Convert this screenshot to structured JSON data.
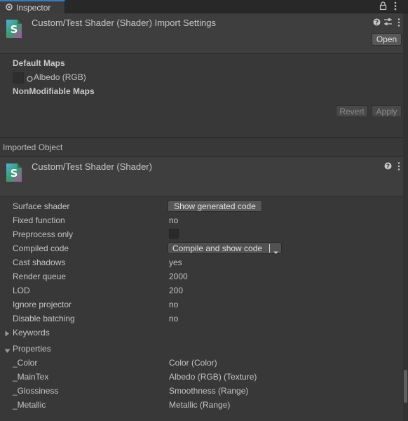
{
  "tab": {
    "label": "Inspector"
  },
  "header": {
    "title": "Custom/Test Shader (Shader) Import Settings",
    "open_label": "Open",
    "help_icon": "help-icon",
    "preset_icon": "preset-sliders-icon",
    "menu_icon": "kebab-menu-icon"
  },
  "maps": {
    "default_title": "Default Maps",
    "albedo_label": "Albedo (RGB)",
    "nonmodifiable_title": "NonModifiable Maps"
  },
  "actions": {
    "revert_label": "Revert",
    "apply_label": "Apply"
  },
  "imported": {
    "section_label": "Imported Object",
    "title": "Custom/Test Shader (Shader)"
  },
  "props": {
    "surface_shader_label": "Surface shader",
    "show_generated_label": "Show generated code",
    "fixed_function_label": "Fixed function",
    "fixed_function_value": "no",
    "preprocess_label": "Preprocess only",
    "compiled_code_label": "Compiled code",
    "compile_btn_label": "Compile and show code",
    "cast_shadows_label": "Cast shadows",
    "cast_shadows_value": "yes",
    "render_queue_label": "Render queue",
    "render_queue_value": "2000",
    "lod_label": "LOD",
    "lod_value": "200",
    "ignore_projector_label": "Ignore projector",
    "ignore_projector_value": "no",
    "disable_batching_label": "Disable batching",
    "disable_batching_value": "no"
  },
  "keywords_label": "Keywords",
  "properties": {
    "label": "Properties",
    "items": [
      {
        "name": "_Color",
        "type": "Color (Color)"
      },
      {
        "name": "_MainTex",
        "type": "Albedo (RGB) (Texture)"
      },
      {
        "name": "_Glossiness",
        "type": "Smoothness (Range)"
      },
      {
        "name": "_Metallic",
        "type": "Metallic (Range)"
      }
    ]
  }
}
